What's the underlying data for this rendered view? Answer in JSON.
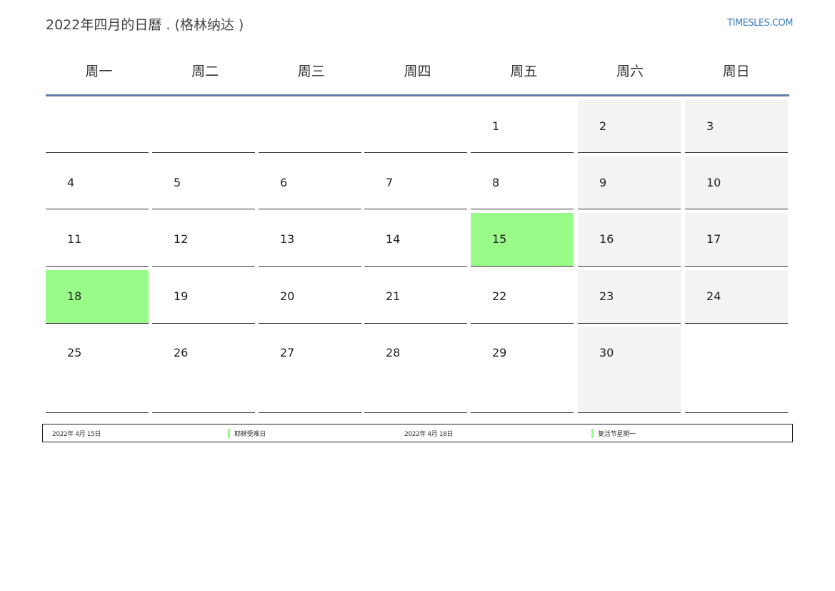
{
  "title": "2022年四月的日曆 . (格林纳达 )",
  "site": "TIMESLES.COM",
  "weekdays": [
    "周一",
    "周二",
    "周三",
    "周四",
    "周五",
    "周六",
    "周日"
  ],
  "weeks": [
    [
      "",
      "",
      "",
      "",
      "1",
      "2",
      "3"
    ],
    [
      "4",
      "5",
      "6",
      "7",
      "8",
      "9",
      "10"
    ],
    [
      "11",
      "12",
      "13",
      "14",
      "15",
      "16",
      "17"
    ],
    [
      "18",
      "19",
      "20",
      "21",
      "22",
      "23",
      "24"
    ],
    [
      "25",
      "26",
      "27",
      "28",
      "29",
      "30",
      ""
    ]
  ],
  "highlighted_days": [
    "15",
    "18"
  ],
  "colors": {
    "holiday": "#99fc88",
    "weekend": "#f3f3f3",
    "header_rule": "#5f7da1",
    "link": "#3a7bbf"
  },
  "holidays": [
    {
      "date": "2022年 4月 15日",
      "name": "耶稣受难日"
    },
    {
      "date": "2022年 4月 18日",
      "name": "复活节星期一"
    }
  ]
}
